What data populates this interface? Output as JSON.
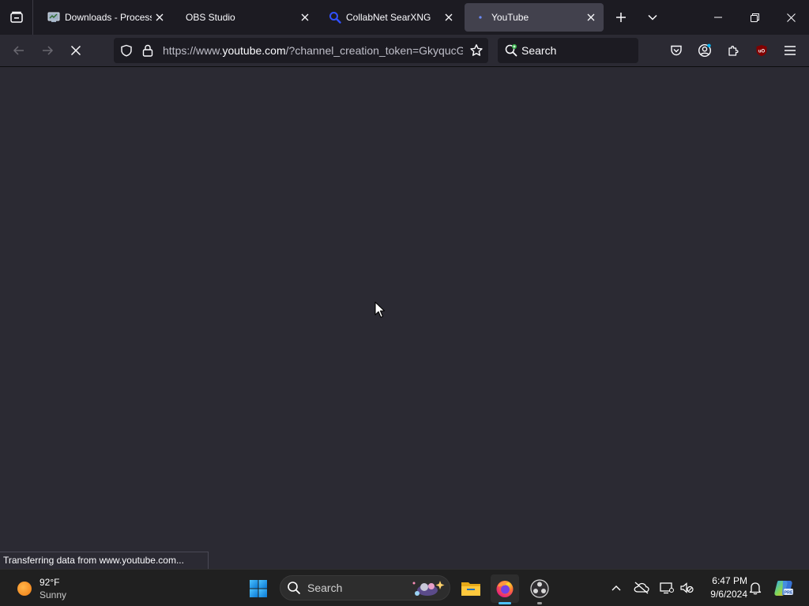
{
  "browser": {
    "tabs": [
      {
        "title": "Downloads - Process H",
        "icon": "process-hacker-icon",
        "active": false
      },
      {
        "title": "OBS Studio",
        "icon": "none",
        "active": false
      },
      {
        "title": "CollabNet SearXNG",
        "icon": "search-icon",
        "active": false
      },
      {
        "title": "YouTube",
        "icon": "loading-dot-icon",
        "active": true
      }
    ],
    "url": {
      "scheme": "https://www.",
      "host": "youtube.com",
      "path": "/?channel_creation_token=GkyqucG"
    },
    "search_placeholder": "Search",
    "status_text": "Transferring data from www.youtube.com...",
    "accent_color": "#2b2a33"
  },
  "taskbar": {
    "weather": {
      "temp": "92°F",
      "condition": "Sunny"
    },
    "search_placeholder": "Search",
    "pinned": [
      "windows-start-icon",
      "file-explorer-icon",
      "firefox-icon",
      "obs-icon"
    ],
    "clock": {
      "time": "6:47 PM",
      "date": "9/6/2024"
    }
  }
}
